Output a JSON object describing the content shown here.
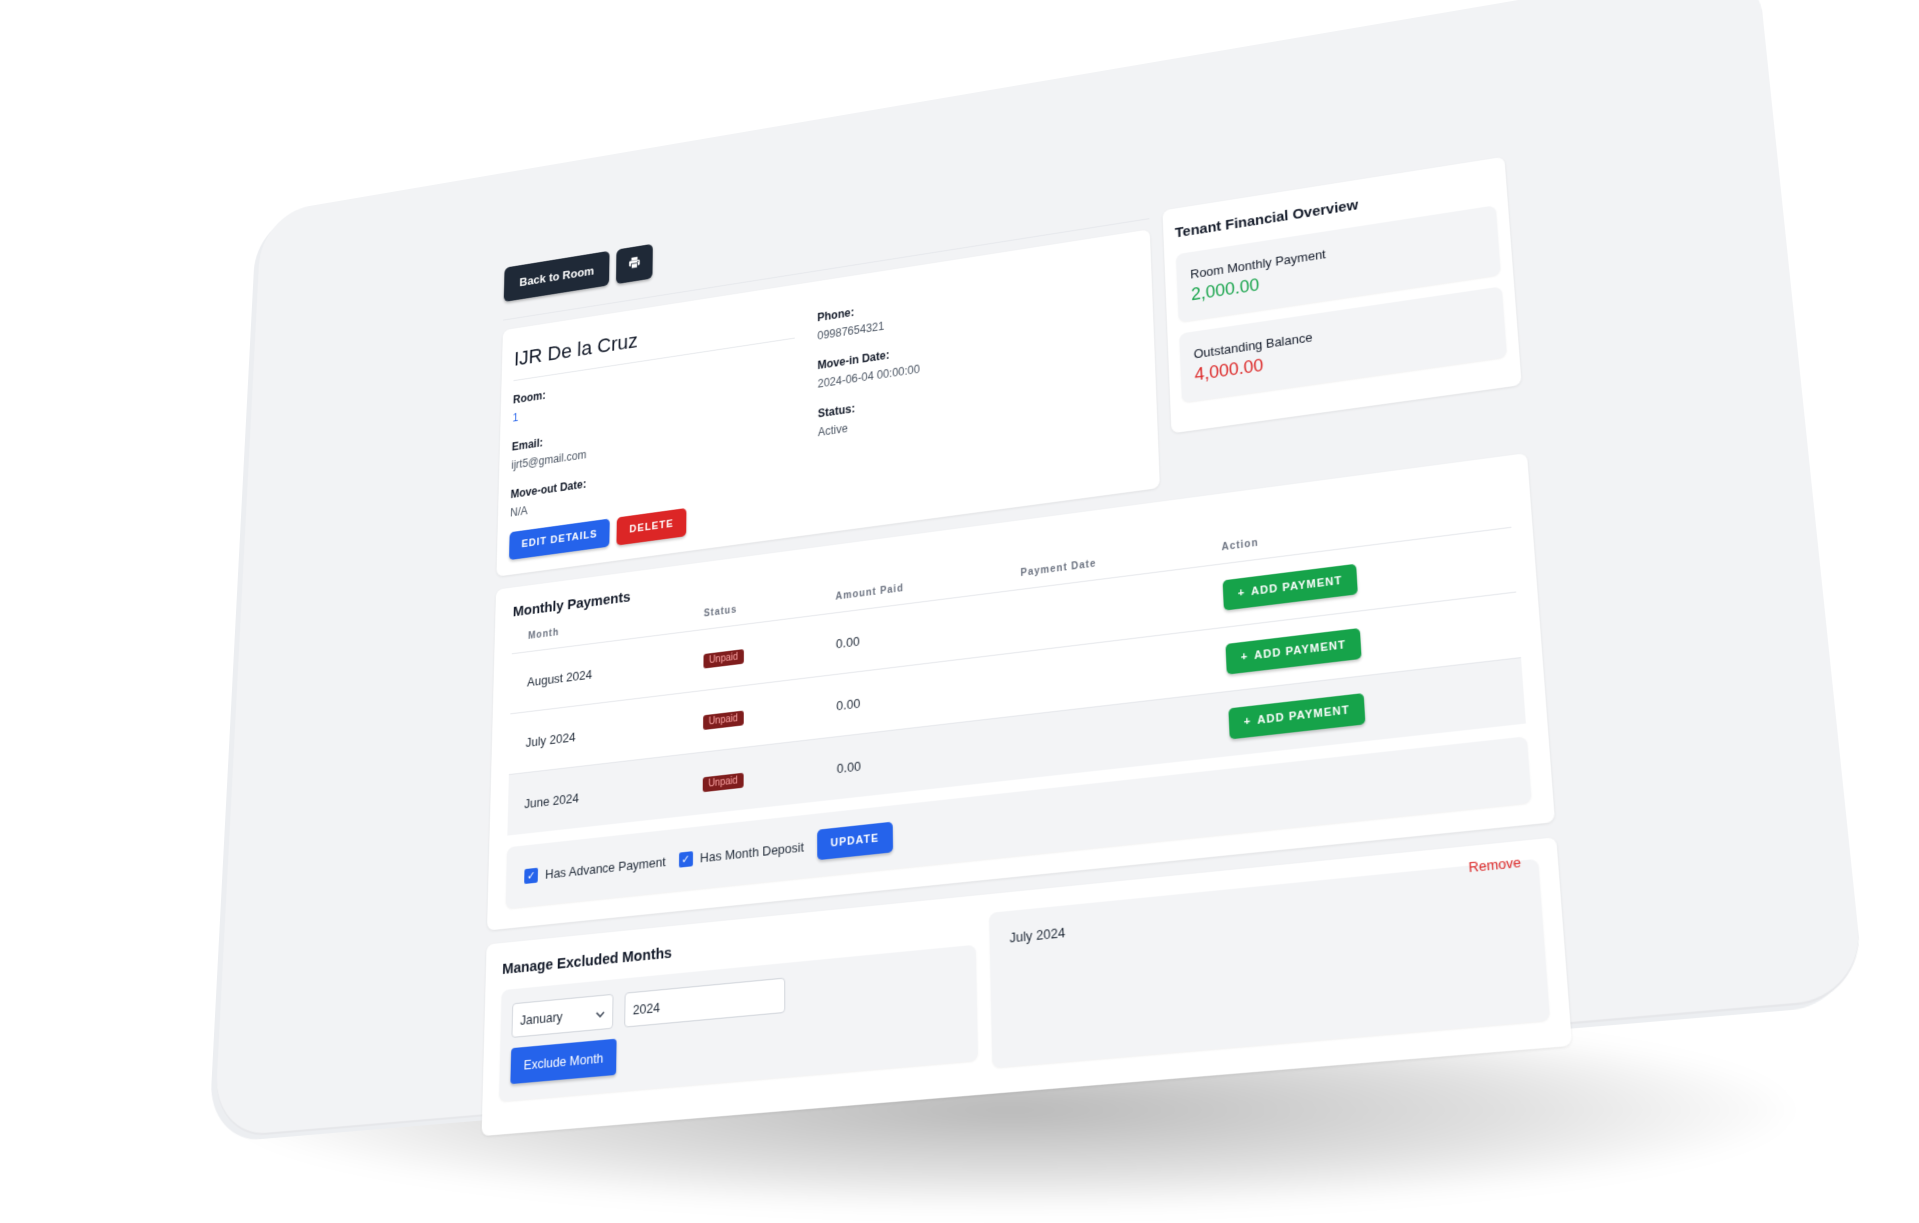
{
  "toolbar": {
    "back_label": "Back to Room",
    "print_icon": "printer-icon"
  },
  "tenant": {
    "name": "IJR De la Cruz",
    "room_label": "Room:",
    "room_value": "1",
    "email_label": "Email:",
    "email_value": "ijrt5@gmail.com",
    "moveout_label": "Move-out Date:",
    "moveout_value": "N/A",
    "phone_label": "Phone:",
    "phone_value": "09987654321",
    "movein_label": "Move-in Date:",
    "movein_value": "2024-06-04 00:00:00",
    "status_label": "Status:",
    "status_value": "Active",
    "edit_label": "Edit Details",
    "delete_label": "Delete"
  },
  "overview": {
    "title": "Tenant Financial Overview",
    "monthly_label": "Room Monthly Payment",
    "monthly_value": "2,000.00",
    "balance_label": "Outstanding Balance",
    "balance_value": "4,000.00",
    "colors": {
      "positive": "#16a34a",
      "negative": "#dc2626"
    }
  },
  "payments": {
    "title": "Monthly Payments",
    "columns": [
      "Month",
      "Status",
      "Amount Paid",
      "Payment Date",
      "Action"
    ],
    "rows": [
      {
        "month": "August 2024",
        "status": "Unpaid",
        "amount": "0.00",
        "date": "",
        "action": "Add Payment"
      },
      {
        "month": "July 2024",
        "status": "Unpaid",
        "amount": "0.00",
        "date": "",
        "action": "Add Payment"
      },
      {
        "month": "June 2024",
        "status": "Unpaid",
        "amount": "0.00",
        "date": "",
        "action": "Add Payment"
      }
    ],
    "advance_label": "Has Advance Payment",
    "advance_checked": true,
    "deposit_label": "Has Month Deposit",
    "deposit_checked": true,
    "update_label": "Update"
  },
  "excluded": {
    "title": "Manage Excluded Months",
    "month_selected": "January",
    "year_value": "2024",
    "exclude_label": "Exclude Month",
    "items": [
      {
        "label": "July 2024",
        "remove_label": "Remove"
      }
    ]
  }
}
